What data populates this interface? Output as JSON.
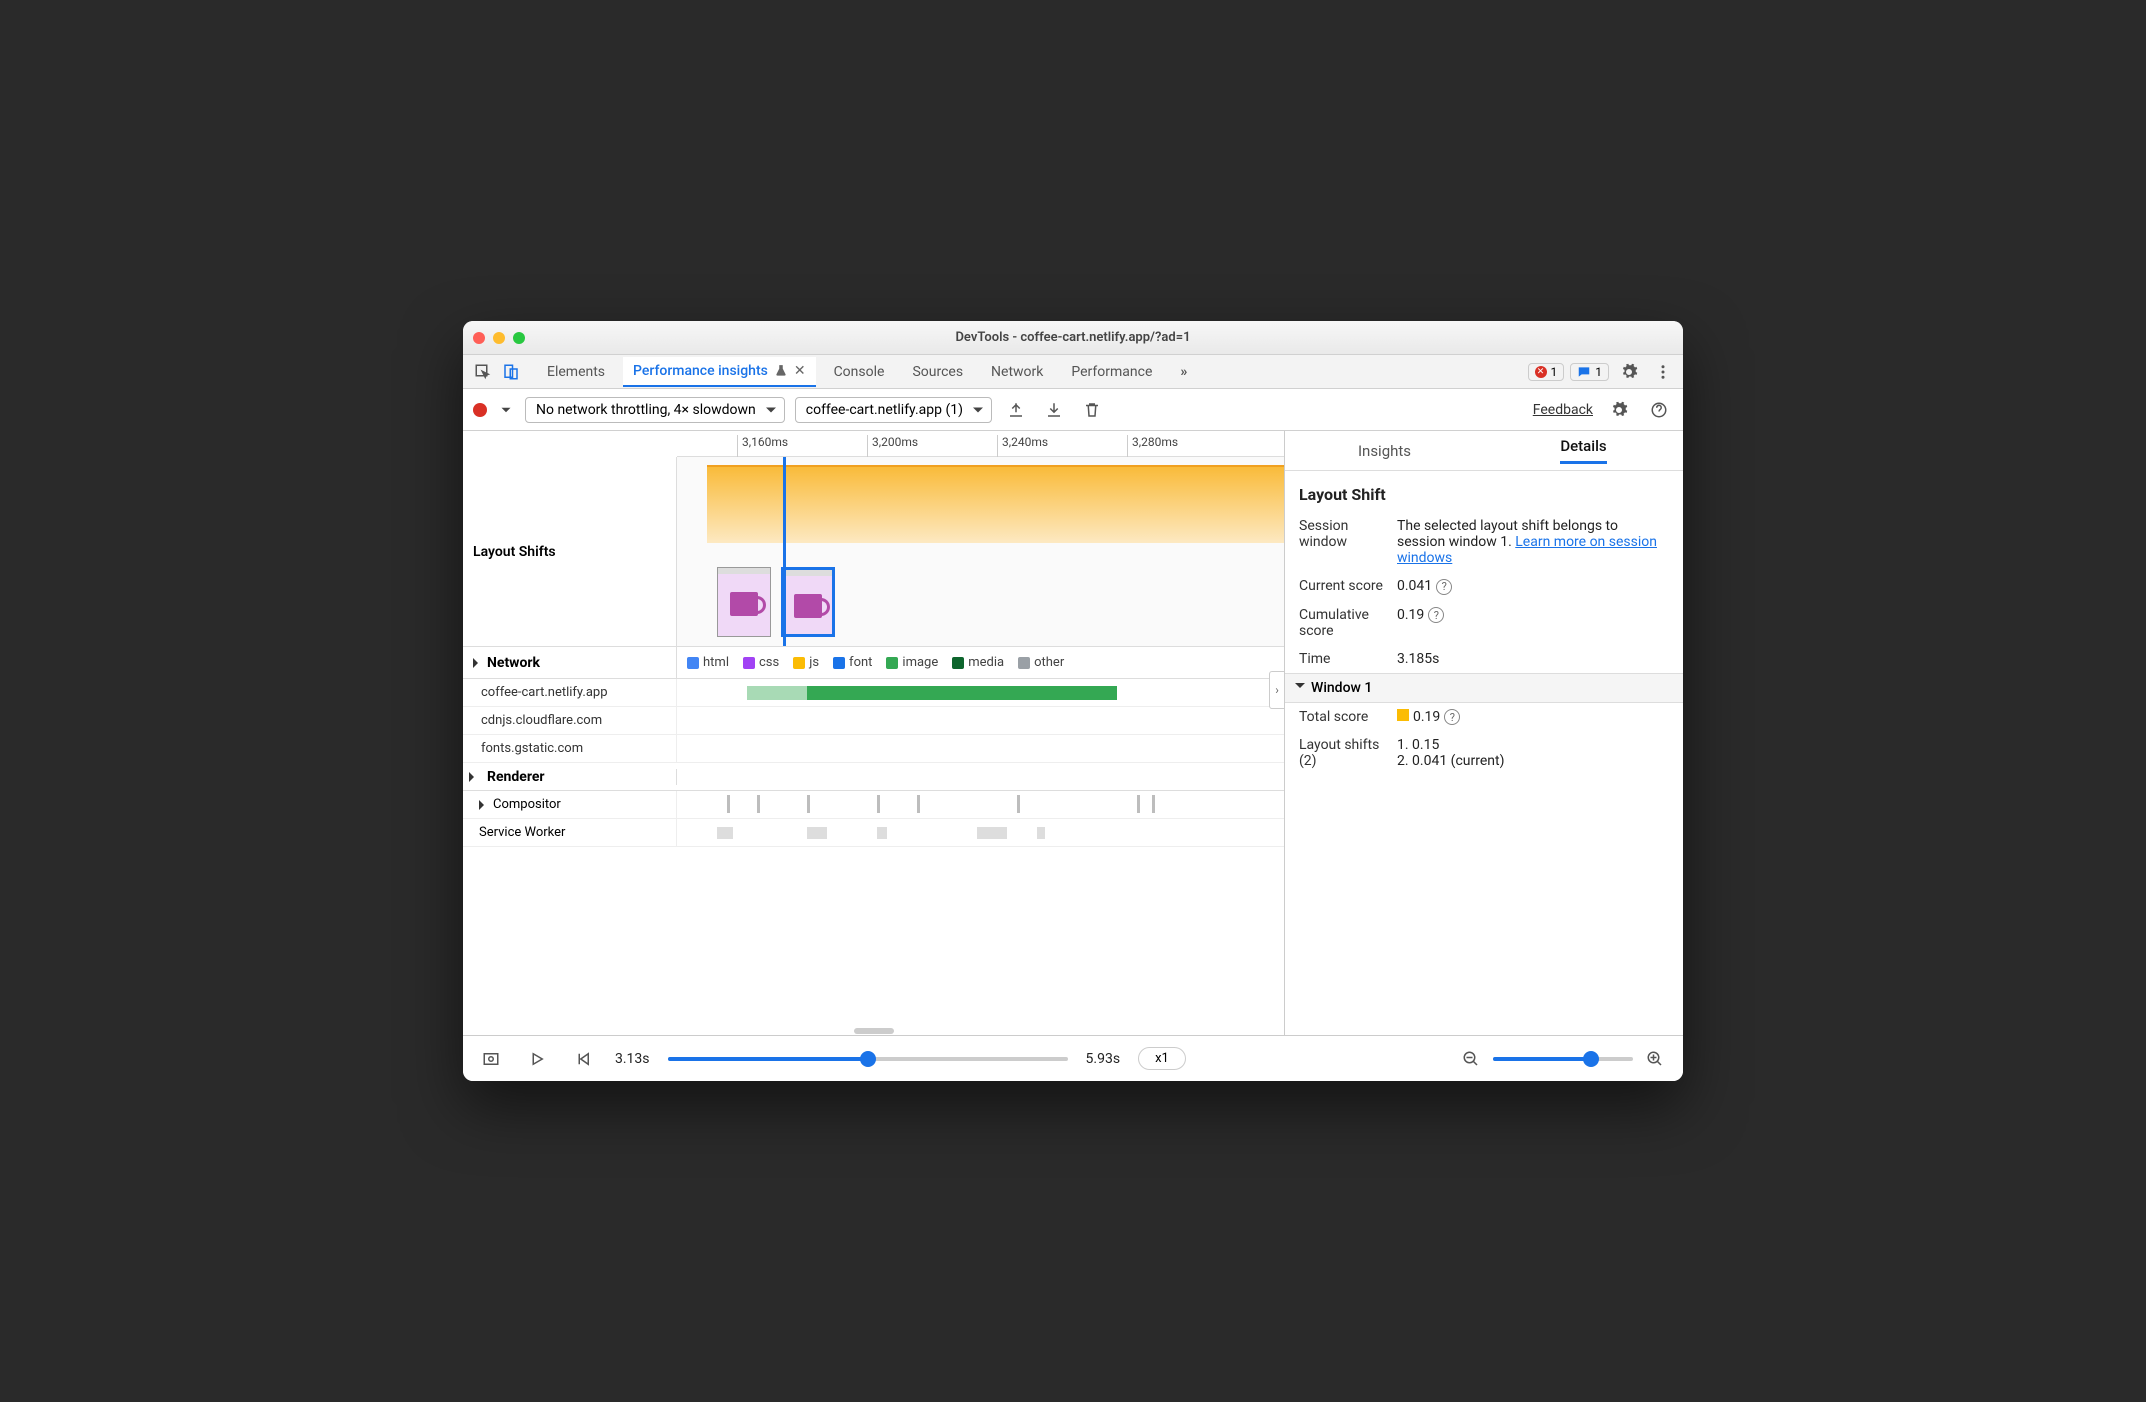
{
  "window_title": "DevTools - coffee-cart.netlify.app/?ad=1",
  "tabs": {
    "elements": "Elements",
    "perf_insights": "Performance insights",
    "console": "Console",
    "sources": "Sources",
    "network": "Network",
    "performance": "Performance"
  },
  "badges": {
    "errors": "1",
    "messages": "1"
  },
  "toolbar": {
    "throttling": "No network throttling, 4× slowdown",
    "page_select": "coffee-cart.netlify.app (1)",
    "feedback": "Feedback"
  },
  "ruler": {
    "t0": "3,160ms",
    "t1": "3,200ms",
    "t2": "3,240ms",
    "t3": "3,280ms"
  },
  "rows": {
    "layout_shifts": "Layout Shifts",
    "network": "Network",
    "renderer": "Renderer",
    "compositor": "Compositor",
    "service_worker": "Service Worker"
  },
  "legend": {
    "html": "html",
    "css": "css",
    "js": "js",
    "font": "font",
    "image": "image",
    "media": "media",
    "other": "other"
  },
  "hosts": {
    "h1": "coffee-cart.netlify.app",
    "h2": "cdnjs.cloudflare.com",
    "h3": "fonts.gstatic.com"
  },
  "right": {
    "tab_insights": "Insights",
    "tab_details": "Details",
    "title": "Layout Shift",
    "session_window_k": "Session window",
    "session_window_v": "The selected layout shift belongs to session window 1. ",
    "session_window_link": "Learn more on session windows",
    "current_score_k": "Current score",
    "current_score_v": "0.041",
    "cum_score_k": "Cumulative score",
    "cum_score_v": "0.19",
    "time_k": "Time",
    "time_v": "3.185s",
    "window1": "Window 1",
    "total_score_k": "Total score",
    "total_score_v": "0.19",
    "ls_k": "Layout shifts (2)",
    "ls_1": "1. 0.15",
    "ls_2": "2. 0.041 (current)"
  },
  "bottom": {
    "start": "3.13s",
    "end": "5.93s",
    "speed": "x1"
  }
}
